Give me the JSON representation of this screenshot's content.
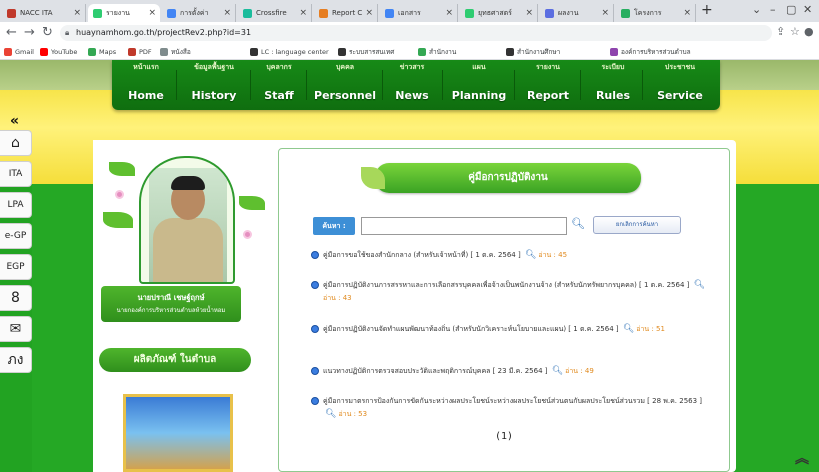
{
  "browser": {
    "tabs": [
      {
        "label": "NACC ITA",
        "color": "#c0392b"
      },
      {
        "label": "รายงาน",
        "color": "#2ecc71"
      },
      {
        "label": "การตั้งค่า",
        "color": "#4285f4"
      },
      {
        "label": "Crossfire",
        "color": "#1abc9c"
      },
      {
        "label": "Report C",
        "color": "#e67e22"
      },
      {
        "label": "เอกสาร",
        "color": "#4285f4"
      },
      {
        "label": "ยุทธศาสตร์",
        "color": "#2ecc71"
      },
      {
        "label": "ผลงาน",
        "color": "#5b6ee1"
      },
      {
        "label": "โครงการ",
        "color": "#27ae60"
      }
    ],
    "url": "huaynamhom.go.th/projectRev2.php?id=31",
    "bookmarks": [
      {
        "label": "Gmail",
        "color": "#ea4335"
      },
      {
        "label": "YouTube",
        "color": "#ff0000"
      },
      {
        "label": "Maps",
        "color": "#34a853"
      },
      {
        "label": "PDF",
        "color": "#c0392b"
      },
      {
        "label": "หนังสือ",
        "color": "#7f8c8d"
      },
      {
        "label": "LC : language center",
        "color": "#333333"
      },
      {
        "label": "ระบบสารสนเทศ",
        "color": "#333333"
      },
      {
        "label": "สำนักงาน",
        "color": "#34a853"
      },
      {
        "label": "สำนักงานศึกษา",
        "color": "#333333"
      },
      {
        "label": "องค์การบริหารส่วนตำบล",
        "color": "#8e44ad"
      }
    ]
  },
  "nav": [
    {
      "th": "หน้าแรก",
      "en": "Home"
    },
    {
      "th": "ข้อมูลพื้นฐาน",
      "en": "History"
    },
    {
      "th": "บุคลากร",
      "en": "Staff"
    },
    {
      "th": "บุคคล",
      "en": "Personnel"
    },
    {
      "th": "ข่าวสาร",
      "en": "News"
    },
    {
      "th": "แผน",
      "en": "Planning"
    },
    {
      "th": "รายงาน",
      "en": "Report"
    },
    {
      "th": "ระเบียบ",
      "en": "Rules"
    },
    {
      "th": "ประชาชน",
      "en": "Service"
    }
  ],
  "sidebar": [
    "⌂",
    "ITA",
    "LPA",
    "e-GP",
    "EGP",
    "8",
    "✉",
    "ภง"
  ],
  "profile": {
    "name": "นายปราณี เชษฐ์ฤกษ์",
    "position": "นายกองค์การบริหารส่วนตำบลห้วยน้ำหอม"
  },
  "products_label": "ผลิตภัณฑ์ ในตำบล",
  "panel": {
    "title": "คู่มือการปฏิบัติงาน",
    "search_label": "ค้นหา :",
    "search_value": "",
    "cancel_label": "ยกเลิกการค้นหา",
    "documents": [
      {
        "text": "คู่มือการขอใช้ของสำนักกลาง (สำหรับเจ้าหน้าที่) [ 1 ต.ค. 2564 ]",
        "reads": "อ่าน : 45"
      },
      {
        "text": "คู่มือการปฏิบัติงานการสรรหาและการเลือกสรรบุคคลเพื่อจ้างเป็นพนักงานจ้าง (สำหรับนักทรัพยากรบุคคล) [ 1 ต.ค. 2564 ]",
        "reads": "อ่าน : 43"
      },
      {
        "text": "คู่มือการปฏิบัติงานจัดทำแผนพัฒนาท้องถิ่น (สำหรับนักวิเคราะห์นโยบายและแผน) [ 1 ต.ค. 2564 ]",
        "reads": "อ่าน : 51"
      },
      {
        "text": "แนวทางปฏิบัติการตรวจสอบประวัติและพฤติการณ์บุคคล [ 23 มี.ค. 2564 ]",
        "reads": "อ่าน : 49"
      },
      {
        "text": "คู่มือการมาตรการป้องกันการขัดกันระหว่างผลประโยชน์ระหว่างผลประโยชน์ส่วนตนกับผลประโยชน์ส่วนรวม [ 28 พ.ค. 2563 ]",
        "reads": "อ่าน : 53"
      }
    ],
    "page_indicator": "(1)"
  },
  "colors": {
    "nav_green": "#0f6e0f",
    "page_green": "#22a322",
    "header_yellow": "#f7e44a",
    "link_blue": "#3b7de0",
    "reads_orange": "#e08a1e"
  }
}
